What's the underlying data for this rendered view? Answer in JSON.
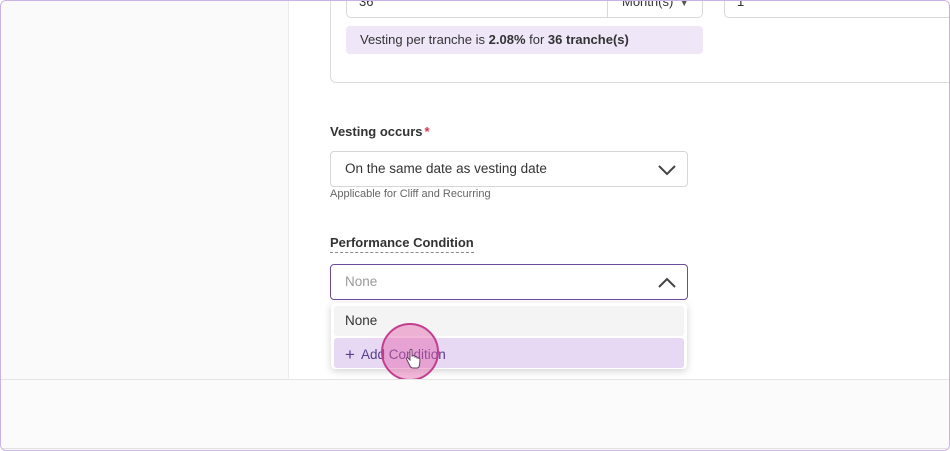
{
  "vesting_card": {
    "period_value": "36",
    "period_unit": "Month(s)",
    "right_value": "1",
    "tranche_prefix": "Vesting per tranche is ",
    "tranche_percent": "2.08%",
    "tranche_mid": " for ",
    "tranche_count": "36 tranche(s)"
  },
  "vesting_occurs": {
    "label": "Vesting occurs",
    "required_mark": "*",
    "value": "On the same date as vesting date",
    "helper": "Applicable for Cliff and Recurring"
  },
  "performance_condition": {
    "label": "Performance Condition",
    "placeholder": "None",
    "options": [
      "None",
      "Add Condition"
    ],
    "add_symbol": "+"
  },
  "colors": {
    "accent": "#6b4c9a",
    "highlight": "#e7d9f4",
    "tranche_bg": "#efe6f8",
    "required": "#d6344e",
    "cursor": "#e260aa"
  }
}
